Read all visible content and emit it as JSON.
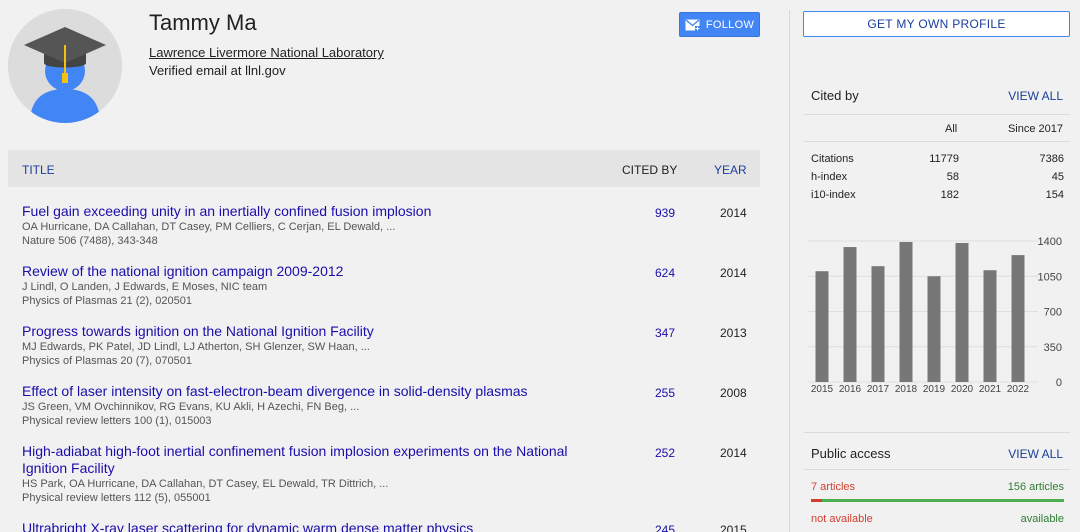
{
  "profile": {
    "name": "Tammy Ma",
    "affiliation": "Lawrence Livermore National Laboratory",
    "email": "Verified email at llnl.gov",
    "follow_label": "FOLLOW"
  },
  "table": {
    "headers": {
      "title": "TITLE",
      "cited_by": "CITED BY",
      "year": "YEAR"
    },
    "rows": [
      {
        "title": "Fuel gain exceeding unity in an inertially confined fusion implosion",
        "authors": "OA Hurricane, DA Callahan, DT Casey, PM Celliers, C Cerjan, EL Dewald, ...",
        "venue": "Nature 506 (7488), 343-348",
        "cited": "939",
        "year": "2014"
      },
      {
        "title": "Review of the national ignition campaign 2009-2012",
        "authors": "J Lindl, O Landen, J Edwards, E Moses, NIC team",
        "venue": "Physics of Plasmas 21 (2), 020501",
        "cited": "624",
        "year": "2014"
      },
      {
        "title": "Progress towards ignition on the National Ignition Facility",
        "authors": "MJ Edwards, PK Patel, JD Lindl, LJ Atherton, SH Glenzer, SW Haan, ...",
        "venue": "Physics of Plasmas 20 (7), 070501",
        "cited": "347",
        "year": "2013"
      },
      {
        "title": "Effect of laser intensity on fast-electron-beam divergence in solid-density plasmas",
        "authors": "JS Green, VM Ovchinnikov, RG Evans, KU Akli, H Azechi, FN Beg, ...",
        "venue": "Physical review letters 100 (1), 015003",
        "cited": "255",
        "year": "2008"
      },
      {
        "title": "High-adiabat high-foot inertial confinement fusion implosion experiments on the National Ignition Facility",
        "authors": "HS Park, OA Hurricane, DA Callahan, DT Casey, EL Dewald, TR Dittrich, ...",
        "venue": "Physical review letters 112 (5), 055001",
        "cited": "252",
        "year": "2014"
      },
      {
        "title": "Ultrabright X-ray laser scattering for dynamic warm dense matter physics",
        "authors": "",
        "venue": "",
        "cited": "245",
        "year": "2015"
      }
    ]
  },
  "sidebar": {
    "get_profile_label": "GET MY OWN PROFILE",
    "cited_by": {
      "title": "Cited by",
      "view_all": "VIEW ALL",
      "col_all": "All",
      "col_since": "Since 2017",
      "rows": [
        {
          "label": "Citations",
          "all": "11779",
          "since": "7386"
        },
        {
          "label": "h-index",
          "all": "58",
          "since": "45"
        },
        {
          "label": "i10-index",
          "all": "182",
          "since": "154"
        }
      ]
    },
    "public_access": {
      "title": "Public access",
      "view_all": "VIEW ALL",
      "not_available_count": "7 articles",
      "available_count": "156 articles",
      "not_available_label": "not available",
      "available_label": "available",
      "not_available_fraction": 0.043
    }
  },
  "chart_data": {
    "type": "bar",
    "categories": [
      "2015",
      "2016",
      "2017",
      "2018",
      "2019",
      "2020",
      "2021",
      "2022"
    ],
    "values": [
      1100,
      1340,
      1150,
      1390,
      1050,
      1380,
      1110,
      1260
    ],
    "yticks": [
      0,
      350,
      700,
      1050,
      1400
    ],
    "ylim": [
      0,
      1400
    ],
    "color": "#777777"
  },
  "colors": {
    "link": "#1a0dab",
    "accent": "#4285f4",
    "bar": "#777777",
    "red": "#d23f31",
    "green": "#4caf50"
  }
}
